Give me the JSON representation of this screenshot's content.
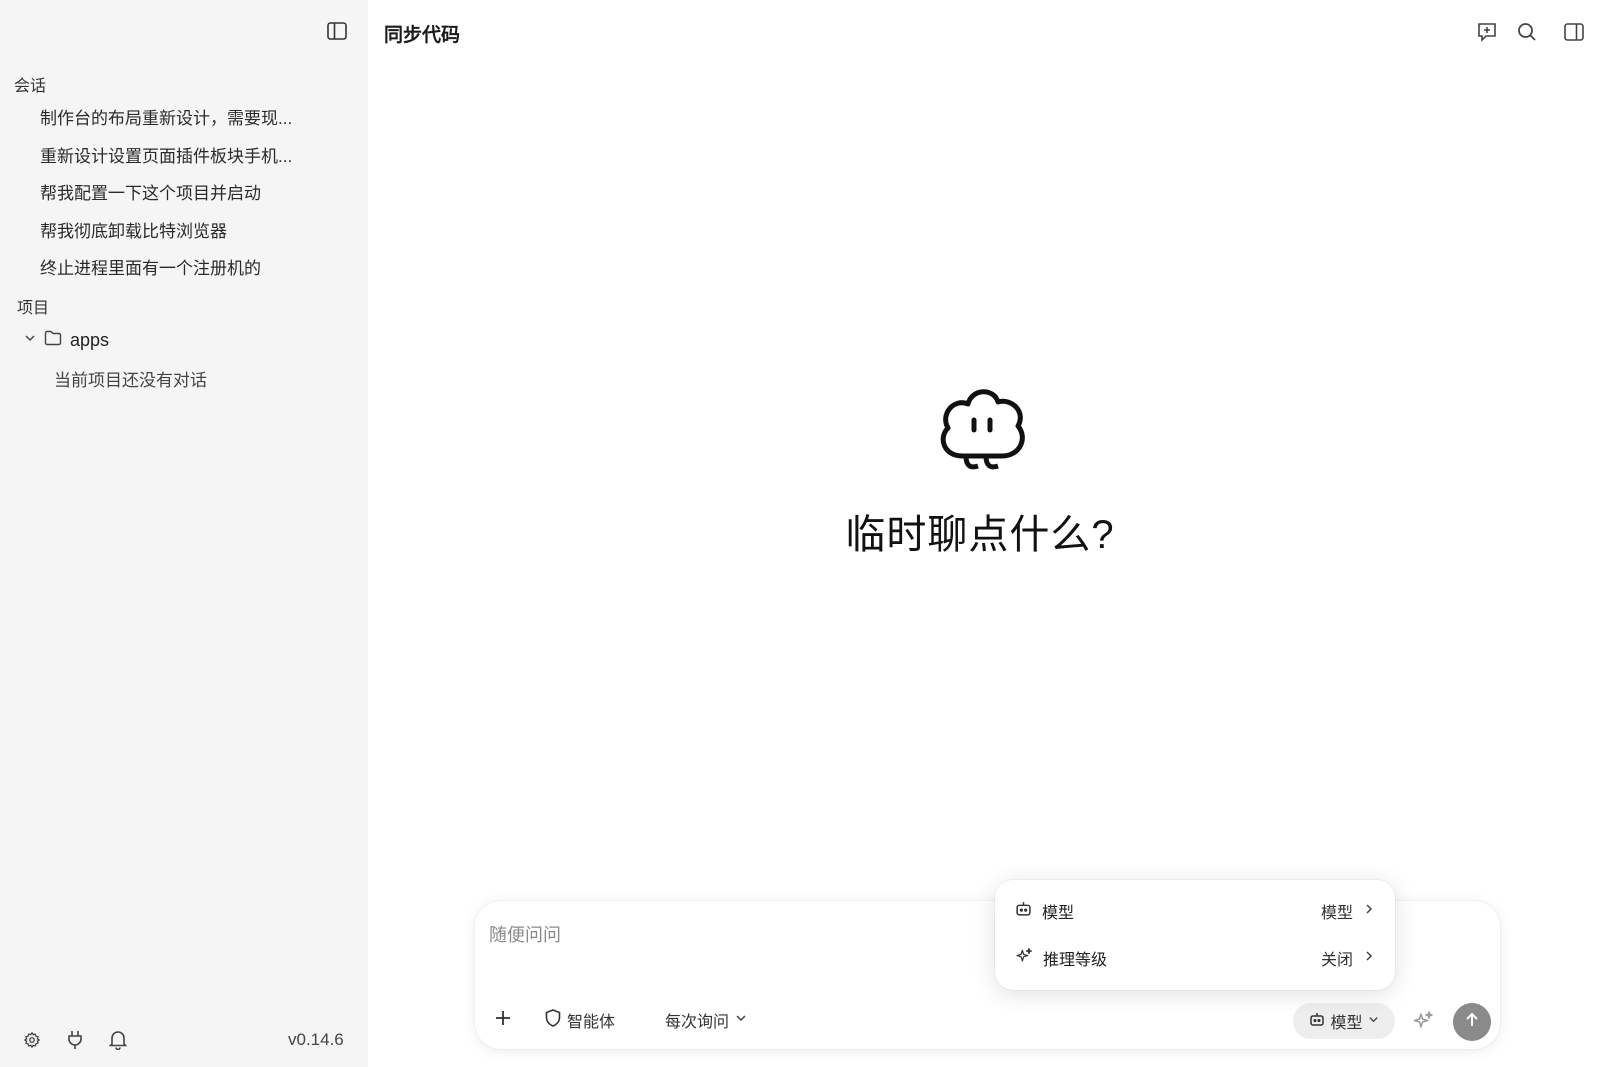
{
  "sidebar": {
    "sessions_label": "会话",
    "conversations": [
      "制作台的布局重新设计，需要现...",
      "重新设计设置页面插件板块手机...",
      "帮我配置一下这个项目并启动",
      "帮我彻底卸载比特浏览器",
      "终止进程里面有一个注册机的"
    ],
    "projects_label": "项目",
    "project": {
      "name": "apps",
      "empty_text": "当前项目还没有对话"
    },
    "version": "v0.14.6"
  },
  "header": {
    "title": "同步代码"
  },
  "main": {
    "hero_text": "临时聊点什么?"
  },
  "composer": {
    "placeholder": "随便问问",
    "agent_label": "智能体",
    "permission_label": "每次询问",
    "model_label": "模型"
  },
  "popup": {
    "rows": [
      {
        "label": "模型",
        "value": "模型"
      },
      {
        "label": "推理等级",
        "value": "关闭"
      }
    ]
  },
  "colors": {
    "sidebar_bg": "#f5f5f5",
    "send_button": "#8a8a8a",
    "accent_text": "#111111"
  }
}
